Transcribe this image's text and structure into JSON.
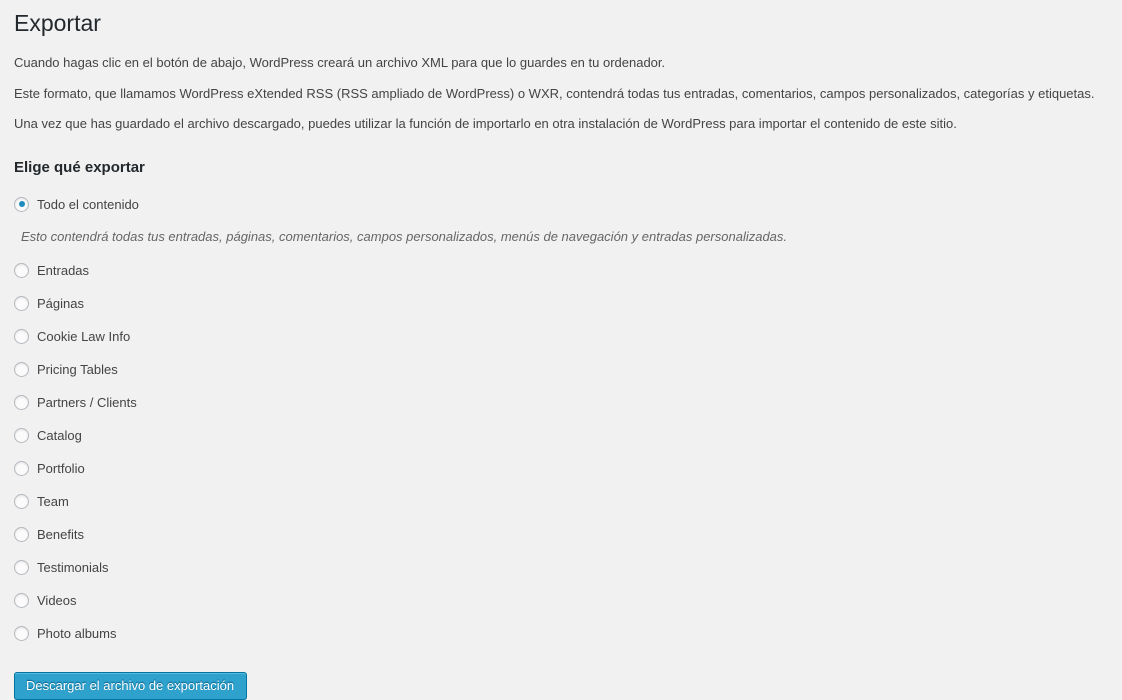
{
  "page": {
    "title": "Exportar",
    "paragraphs": [
      "Cuando hagas clic en el botón de abajo, WordPress creará un archivo XML para que lo guardes en tu ordenador.",
      "Este formato, que llamamos WordPress eXtended RSS (RSS ampliado de WordPress) o WXR, contendrá todas tus entradas, comentarios, campos personalizados, categorías y etiquetas.",
      "Una vez que has guardado el archivo descargado, puedes utilizar la función de importarlo en otra instalación de WordPress para importar el contenido de este sitio."
    ]
  },
  "choose_section": {
    "heading": "Elige qué exportar",
    "all_content_description": "Esto contendrá todas tus entradas, páginas, comentarios, campos personalizados, menús de navegación y entradas personalizadas.",
    "options": [
      {
        "label": "Todo el contenido",
        "selected": true
      },
      {
        "label": "Entradas",
        "selected": false
      },
      {
        "label": "Páginas",
        "selected": false
      },
      {
        "label": "Cookie Law Info",
        "selected": false
      },
      {
        "label": "Pricing Tables",
        "selected": false
      },
      {
        "label": "Partners / Clients",
        "selected": false
      },
      {
        "label": "Catalog",
        "selected": false
      },
      {
        "label": "Portfolio",
        "selected": false
      },
      {
        "label": "Team",
        "selected": false
      },
      {
        "label": "Benefits",
        "selected": false
      },
      {
        "label": "Testimonials",
        "selected": false
      },
      {
        "label": "Videos",
        "selected": false
      },
      {
        "label": "Photo albums",
        "selected": false
      }
    ]
  },
  "submit": {
    "label": "Descargar el archivo de exportación"
  },
  "colors": {
    "background": "#f1f1f1",
    "title_text": "#23282d",
    "body_text": "#444444",
    "muted_text": "#666666",
    "accent_blue": "#2ea2cc",
    "accent_blue_border": "#0074a2",
    "radio_dot": "#1e8cbe",
    "radio_border": "#b4b9be"
  }
}
